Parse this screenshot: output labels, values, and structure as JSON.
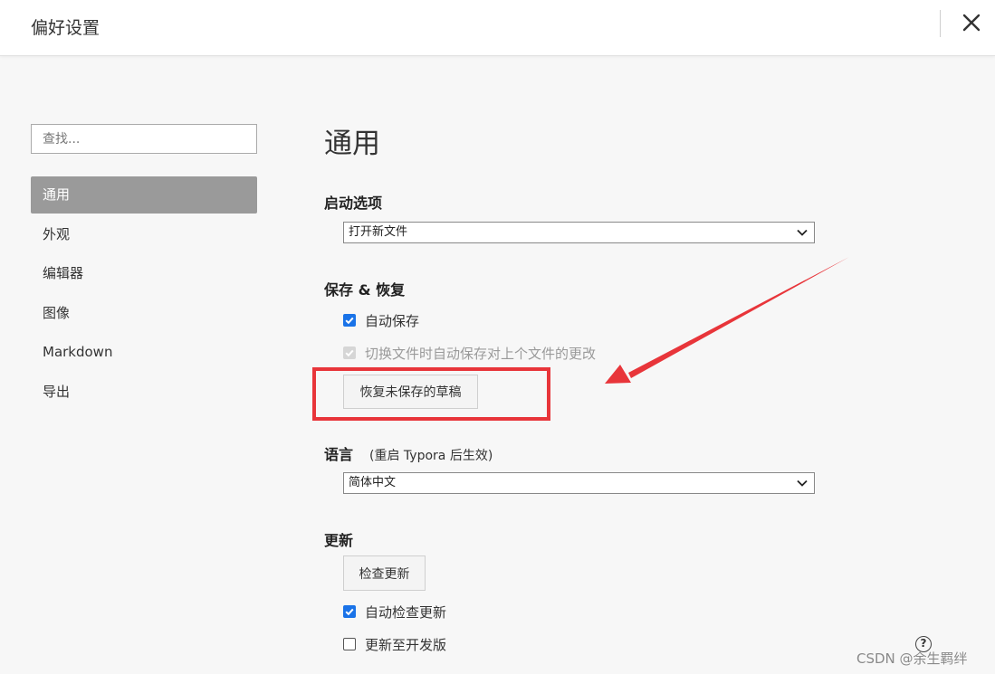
{
  "window": {
    "title": "偏好设置",
    "close_icon": "close-icon"
  },
  "sidebar": {
    "search_placeholder": "查找...",
    "items": [
      {
        "label": "通用",
        "active": true
      },
      {
        "label": "外观"
      },
      {
        "label": "编辑器"
      },
      {
        "label": "图像"
      },
      {
        "label": "Markdown"
      },
      {
        "label": "导出"
      }
    ]
  },
  "main": {
    "title": "通用",
    "startup": {
      "heading": "启动选项",
      "selected": "打开新文件"
    },
    "save_restore": {
      "heading": "保存 & 恢复",
      "auto_save_label": "自动保存",
      "auto_save_checked": true,
      "switch_save_label": "切换文件时自动保存对上个文件的更改",
      "switch_save_checked": true,
      "switch_save_disabled": true,
      "restore_button": "恢复未保存的草稿"
    },
    "language": {
      "heading": "语言",
      "hint": "(重启 Typora 后生效)",
      "selected": "简体中文"
    },
    "update": {
      "heading": "更新",
      "check_button": "检查更新",
      "auto_check_label": "自动检查更新",
      "auto_check_checked": true,
      "dev_build_label": "更新至开发版",
      "dev_build_checked": false
    }
  },
  "annotation": {
    "color": "#e8353a"
  },
  "footer": {
    "help_glyph": "?",
    "watermark": "CSDN @余生羁绊"
  },
  "colors": {
    "accent": "#1a73e8",
    "active_nav": "#9a9a9a",
    "background": "#f7f7f7"
  }
}
